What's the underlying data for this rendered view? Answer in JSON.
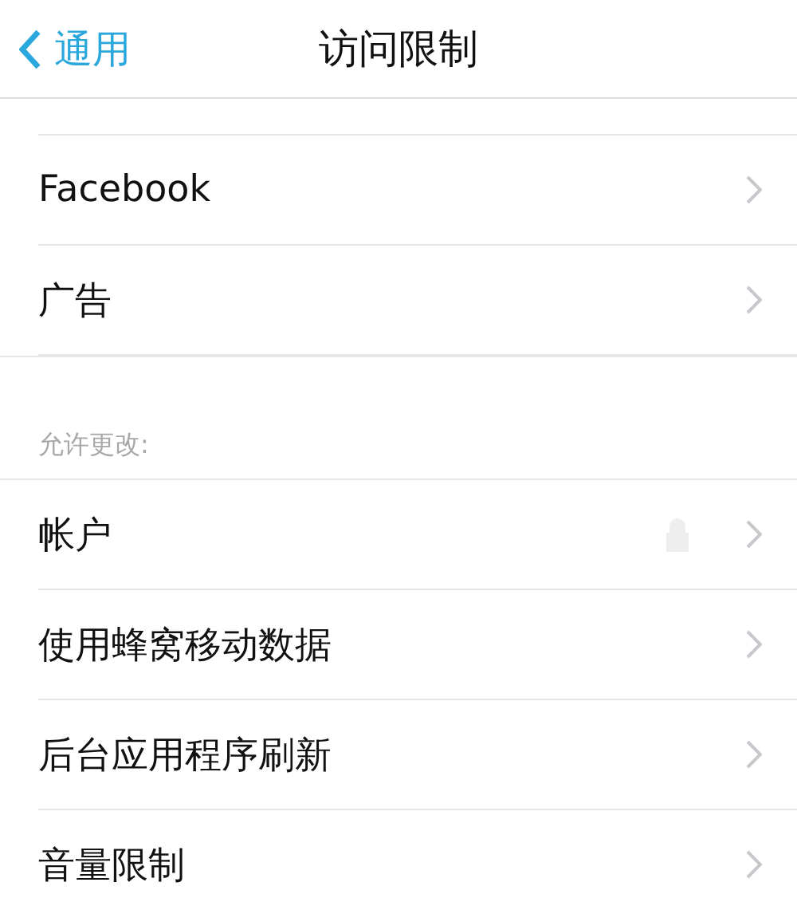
{
  "nav": {
    "back": "通用",
    "title": "访问限制"
  },
  "sections": [
    {
      "rows": [
        {
          "label": "Facebook",
          "locked": false
        },
        {
          "label": "广告",
          "locked": false
        }
      ]
    },
    {
      "header": "允许更改:",
      "rows": [
        {
          "label": "帐户",
          "locked": true
        },
        {
          "label": "使用蜂窝移动数据",
          "locked": false
        },
        {
          "label": "后台应用程序刷新",
          "locked": false
        },
        {
          "label": "音量限制",
          "locked": false
        }
      ]
    }
  ]
}
